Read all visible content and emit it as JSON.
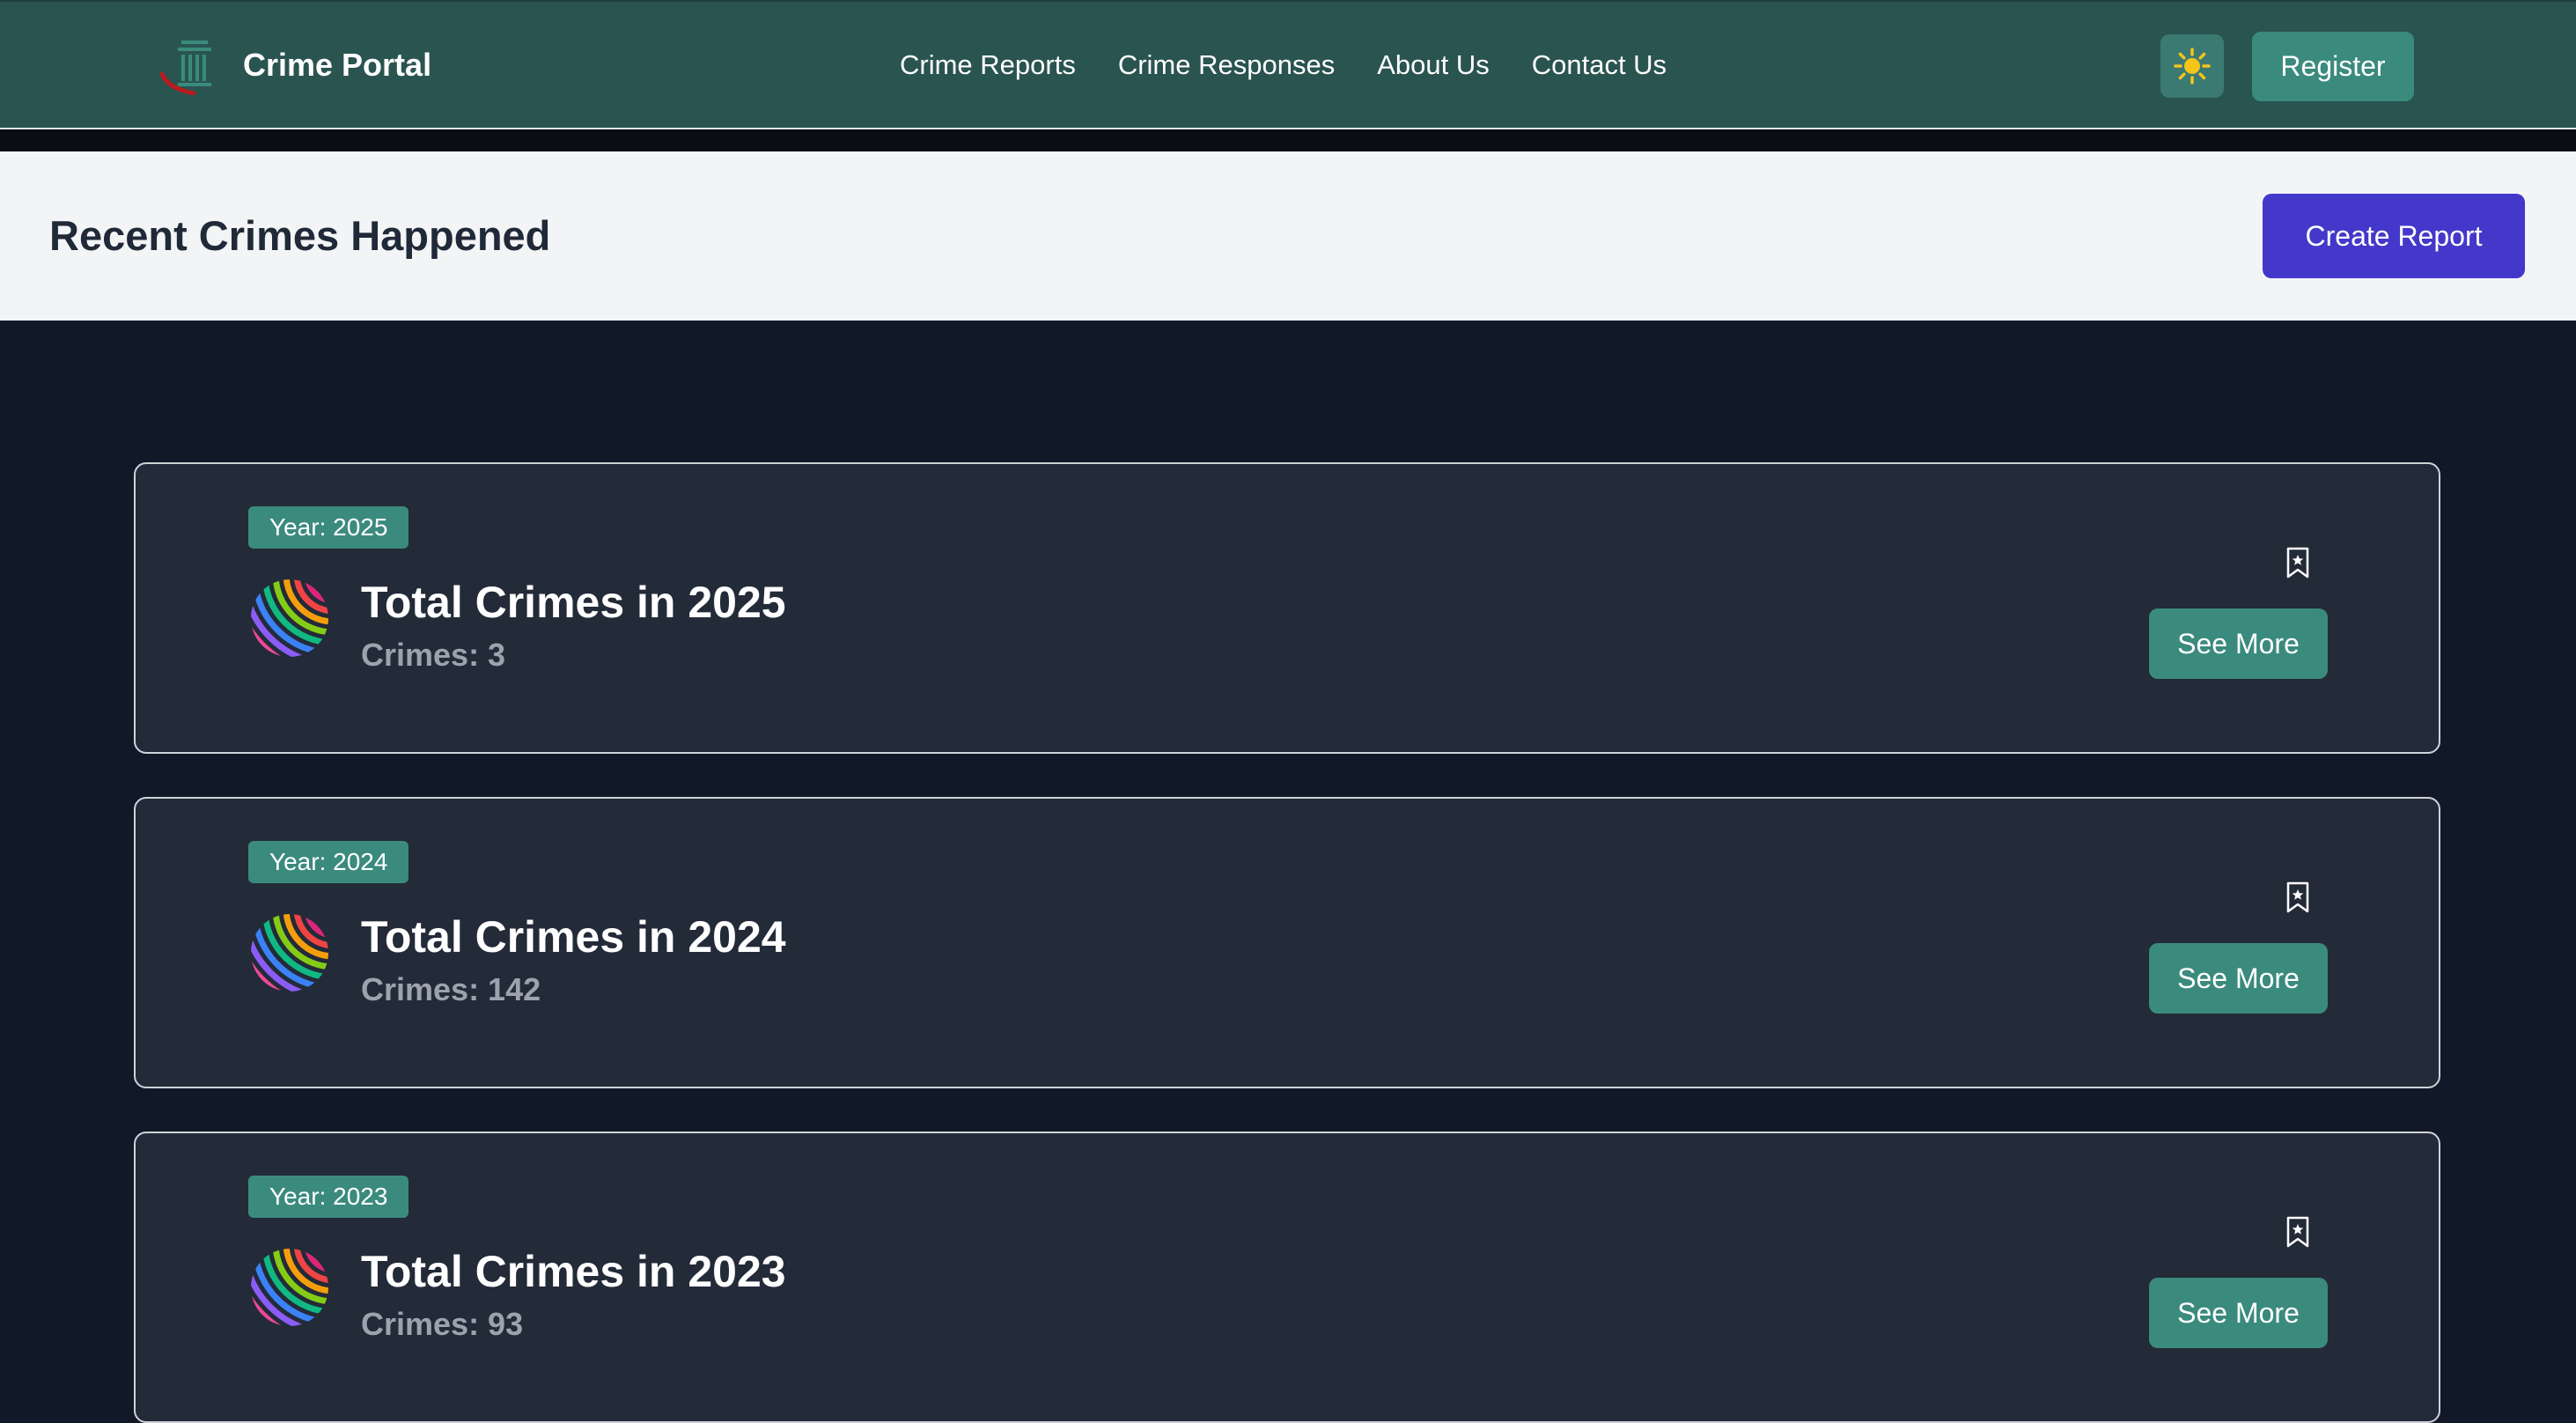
{
  "brand": {
    "name": "Crime Portal",
    "logo_icon": "courthouse-pillar-icon"
  },
  "nav": {
    "links": [
      "Crime Reports",
      "Crime Responses",
      "About Us",
      "Contact Us"
    ]
  },
  "header_actions": {
    "theme_icon": "sun-icon",
    "register_label": "Register"
  },
  "page": {
    "title": "Recent Crimes Happened",
    "create_label": "Create Report"
  },
  "cards": [
    {
      "badge": "Year: 2025",
      "title": "Total Crimes in 2025",
      "count": "Crimes: 3",
      "button": "See More"
    },
    {
      "badge": "Year: 2024",
      "title": "Total Crimes in 2024",
      "count": "Crimes: 142",
      "button": "See More"
    },
    {
      "badge": "Year: 2023",
      "title": "Total Crimes in 2023",
      "count": "Crimes: 93",
      "button": "See More"
    }
  ],
  "colors": {
    "navbar": "#2a5450",
    "accent_teal": "#3b8a7e",
    "primary_indigo": "#4338ca",
    "page_bg": "#111827",
    "card_bg": "#232a38",
    "sun": "#f5c518"
  }
}
